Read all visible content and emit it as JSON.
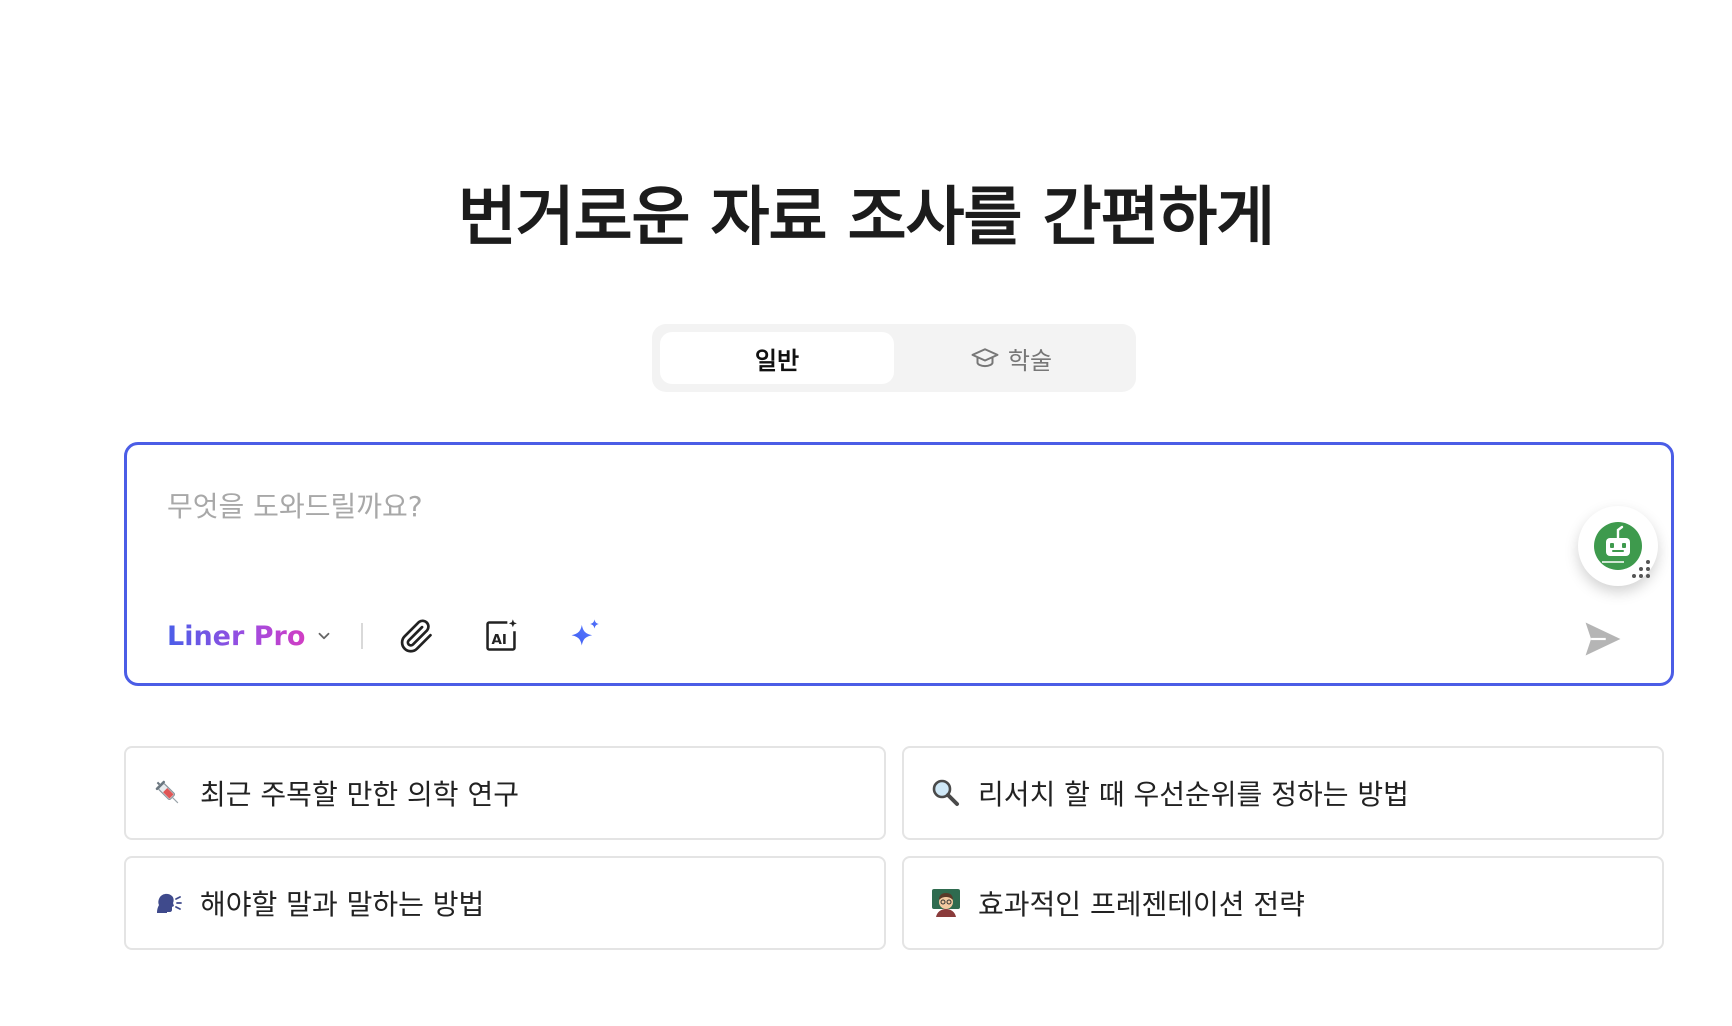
{
  "hero": {
    "title": "번거로운 자료 조사를 간편하게"
  },
  "mode_toggle": {
    "tabs": [
      {
        "label": "일반",
        "active": true
      },
      {
        "label": "학술",
        "active": false,
        "icon": "graduation-cap-icon"
      }
    ]
  },
  "search": {
    "placeholder": "무엇을 도와드릴까요?",
    "value": "",
    "model_label": "Liner Pro",
    "tools": [
      {
        "name": "attach-file",
        "icon": "paperclip-icon"
      },
      {
        "name": "ai-image",
        "icon": "ai-image-icon"
      },
      {
        "name": "ai-sparkle",
        "icon": "sparkle-icon"
      }
    ],
    "send_icon": "send-icon",
    "accent": "#4b5de6"
  },
  "assistant": {
    "icon": "robot-assistant-icon",
    "color": "#3e9a4d"
  },
  "suggestions": [
    {
      "emoji": "syringe-icon",
      "label": "최근 주목할 만한 의학 연구"
    },
    {
      "emoji": "magnifier-icon",
      "label": "리서치 할 때 우선순위를 정하는 방법"
    },
    {
      "emoji": "speaking-head-icon",
      "label": "해야할 말과 말하는 방법"
    },
    {
      "emoji": "teacher-icon",
      "label": "효과적인 프레젠테이션 전략"
    }
  ]
}
